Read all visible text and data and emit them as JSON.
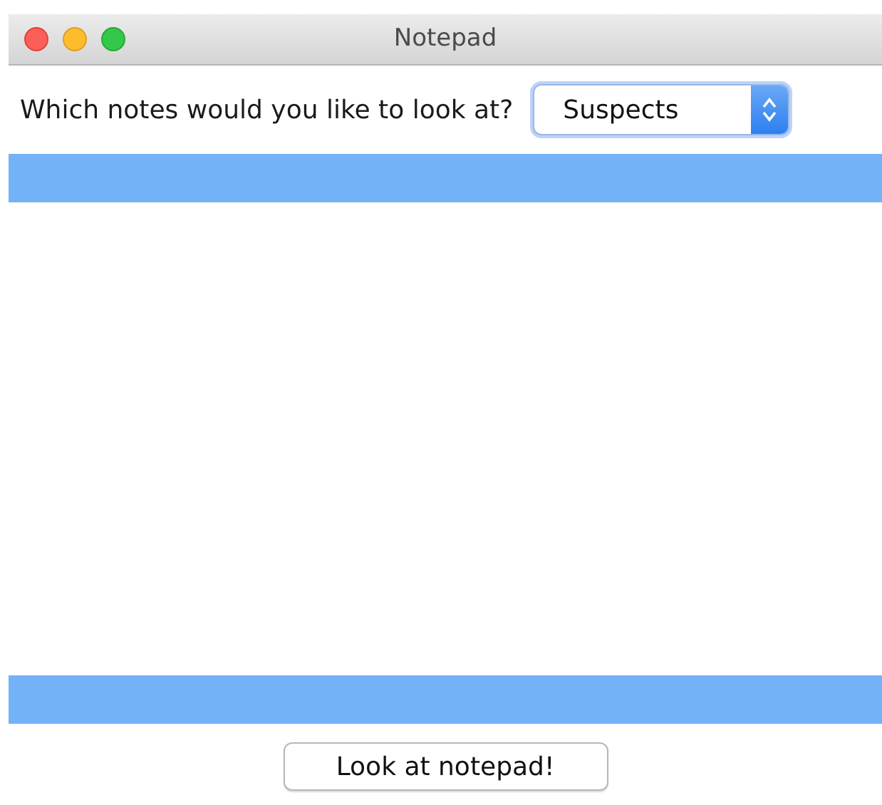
{
  "window": {
    "title": "Notepad"
  },
  "prompt": {
    "label": "Which notes would you like to look at?"
  },
  "notes_select": {
    "value": "Suspects"
  },
  "buttons": [
    "Look at notepad!"
  ]
}
